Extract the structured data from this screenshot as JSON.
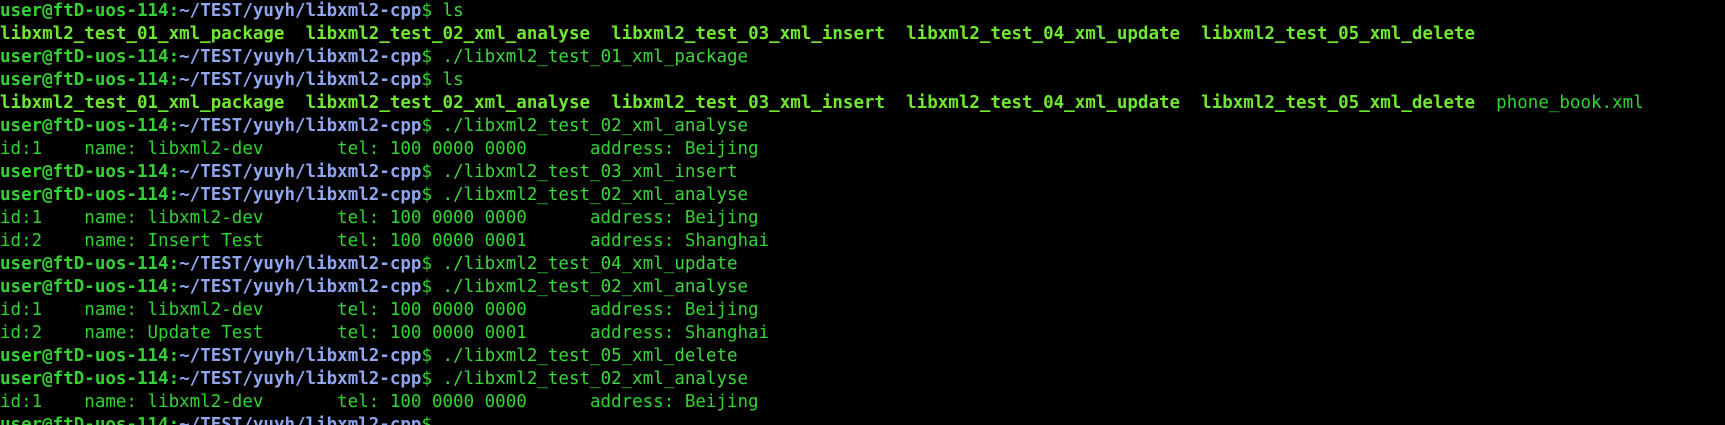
{
  "terminal": {
    "prompt": {
      "user_host": "user@ftD-uos-114",
      "separator": ":",
      "path": "~/TEST/yuyh/libxml2-cpp",
      "dollar": "$ "
    },
    "lines": [
      {
        "type": "prompt",
        "command": "ls"
      },
      {
        "type": "ls",
        "executables": [
          "libxml2_test_01_xml_package",
          "libxml2_test_02_xml_analyse",
          "libxml2_test_03_xml_insert",
          "libxml2_test_04_xml_update",
          "libxml2_test_05_xml_delete"
        ],
        "files": []
      },
      {
        "type": "prompt",
        "command": "./libxml2_test_01_xml_package"
      },
      {
        "type": "prompt",
        "command": "ls"
      },
      {
        "type": "ls",
        "executables": [
          "libxml2_test_01_xml_package",
          "libxml2_test_02_xml_analyse",
          "libxml2_test_03_xml_insert",
          "libxml2_test_04_xml_update",
          "libxml2_test_05_xml_delete"
        ],
        "files": [
          "phone_book.xml"
        ]
      },
      {
        "type": "prompt",
        "command": "./libxml2_test_02_xml_analyse"
      },
      {
        "type": "output",
        "text": "id:1    name: libxml2-dev       tel: 100 0000 0000      address: Beijing"
      },
      {
        "type": "prompt",
        "command": "./libxml2_test_03_xml_insert"
      },
      {
        "type": "prompt",
        "command": "./libxml2_test_02_xml_analyse"
      },
      {
        "type": "output",
        "text": "id:1    name: libxml2-dev       tel: 100 0000 0000      address: Beijing"
      },
      {
        "type": "output",
        "text": "id:2    name: Insert Test       tel: 100 0000 0001      address: Shanghai"
      },
      {
        "type": "prompt",
        "command": "./libxml2_test_04_xml_update"
      },
      {
        "type": "prompt",
        "command": "./libxml2_test_02_xml_analyse"
      },
      {
        "type": "output",
        "text": "id:1    name: libxml2-dev       tel: 100 0000 0000      address: Beijing"
      },
      {
        "type": "output",
        "text": "id:2    name: Update Test       tel: 100 0000 0001      address: Shanghai"
      },
      {
        "type": "prompt",
        "command": "./libxml2_test_05_xml_delete"
      },
      {
        "type": "prompt",
        "command": "./libxml2_test_02_xml_analyse"
      },
      {
        "type": "output",
        "text": "id:1    name: libxml2-dev       tel: 100 0000 0000      address: Beijing"
      },
      {
        "type": "prompt",
        "command": ""
      }
    ]
  },
  "colors": {
    "background": "#000000",
    "user_host": "#35d035",
    "path": "#8fa6ee",
    "executable": "#6ee830",
    "plain_file": "#2fd52f",
    "output_text": "#2fd52f"
  }
}
